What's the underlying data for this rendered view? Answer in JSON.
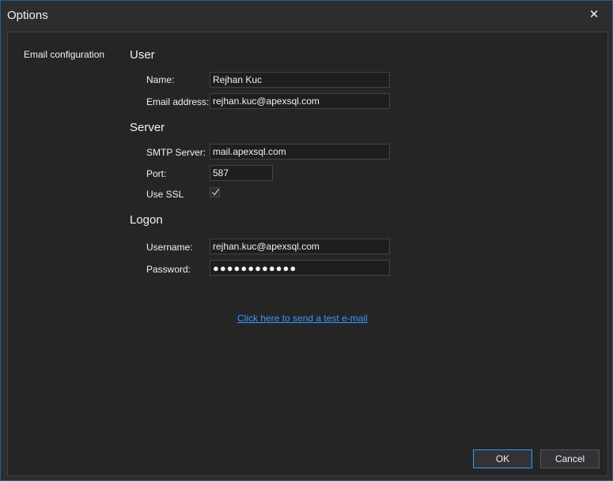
{
  "window": {
    "title": "Options",
    "close_glyph": "✕"
  },
  "nav": {
    "items": [
      {
        "label": "Email configuration"
      }
    ]
  },
  "sections": {
    "user": {
      "title": "User",
      "name_label": "Name:",
      "name_value": "Rejhan Kuc",
      "email_label": "Email address:",
      "email_value": "rejhan.kuc@apexsql.com"
    },
    "server": {
      "title": "Server",
      "smtp_label": "SMTP Server:",
      "smtp_value": "mail.apexsql.com",
      "port_label": "Port:",
      "port_value": "587",
      "ssl_label": "Use SSL",
      "ssl_checked": true
    },
    "logon": {
      "title": "Logon",
      "username_label": "Username:",
      "username_value": "rejhan.kuc@apexsql.com",
      "password_label": "Password:",
      "password_value": "●●●●●●●●●●●●"
    }
  },
  "test_link": "Click here to send a test e-mail",
  "buttons": {
    "ok": "OK",
    "cancel": "Cancel"
  },
  "colors": {
    "accent": "#3399ff",
    "background": "#2d2d30",
    "panel": "#252526"
  }
}
